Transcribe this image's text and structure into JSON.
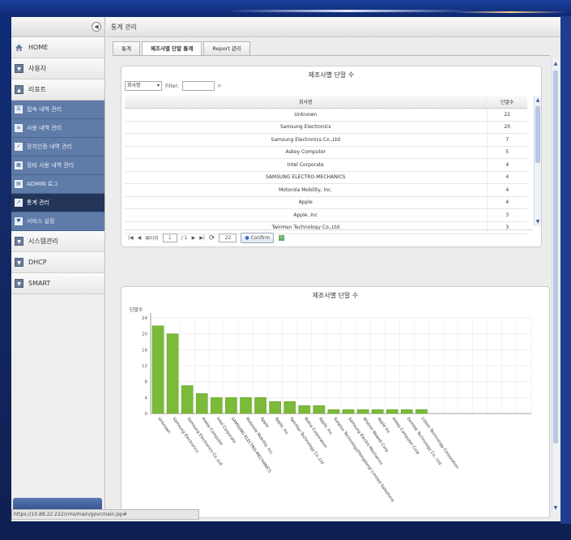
{
  "status_url": "https://10.88.22.222/cms/main/govcmain.jsp#",
  "sidebar": {
    "collapse_icon": "◀",
    "items": [
      {
        "label": "HOME",
        "icon": "home-icon"
      },
      {
        "label": "사용자",
        "icon": "expand-icon"
      },
      {
        "label": "리포트",
        "icon": "collapse-icon"
      }
    ],
    "report_subitems": [
      {
        "label": "접속 내역 관리",
        "icon": "list-icon"
      },
      {
        "label": "사용 내역 관리",
        "icon": "doc-icon"
      },
      {
        "label": "장치인증 내역 관리",
        "icon": "check-icon"
      },
      {
        "label": "장비 사용 내역 관리",
        "icon": "calendar-icon"
      },
      {
        "label": "ADMIN 로그",
        "icon": "log-icon"
      },
      {
        "label": "통계 관리",
        "icon": "chart-icon",
        "active": true
      },
      {
        "label": "서비스 설정",
        "icon": "setting-icon"
      }
    ],
    "items_after": [
      {
        "label": "시스템관리",
        "icon": "expand-icon"
      },
      {
        "label": "DHCP",
        "icon": "expand-icon"
      },
      {
        "label": "SMART",
        "icon": "expand-icon"
      }
    ]
  },
  "breadcrumb": "통계 관리",
  "tabs": [
    {
      "label": "통계",
      "active": false
    },
    {
      "label": "제조사별 단말 통계",
      "active": true
    },
    {
      "label": "Report 관리",
      "active": false
    }
  ],
  "table_panel": {
    "title": "제조사별 단말 수",
    "filter_select": "회사명",
    "filter_label": "Filter:",
    "filter_value": "",
    "columns": [
      "회사명",
      "단말수"
    ],
    "rows": [
      [
        "Unknown",
        "22"
      ],
      [
        "Samsung Electronics",
        "20"
      ],
      [
        "Samsung Electronics Co.,Ltd",
        "7"
      ],
      [
        "Askey Computer",
        "5"
      ],
      [
        "Intel Corporate",
        "4"
      ],
      [
        "SAMSUNG ELECTRO-MECHANICS",
        "4"
      ],
      [
        "Motorola Mobility, Inc.",
        "4"
      ],
      [
        "Apple",
        "4"
      ],
      [
        "Apple, Inc",
        "3"
      ],
      [
        "TwinHan Technology Co.,Ltd",
        "3"
      ]
    ],
    "pager": {
      "page_label": "페이지",
      "page_value": "1",
      "of_label": "/ 1",
      "page_size": "22",
      "confirm_label": "Confirm"
    }
  },
  "chart_panel": {
    "title": "제조사별 단말 수"
  },
  "chart_data": {
    "type": "bar",
    "title": "제조사별 단말 수",
    "ylabel": "단말수",
    "xlabel": "",
    "ylim": [
      0,
      24
    ],
    "yticks": [
      0,
      4,
      8,
      12,
      16,
      20,
      24
    ],
    "grid": true,
    "bar_color": "#7cba3a",
    "categories": [
      "Unknown",
      "Samsung Electronics",
      "Samsung Electronics Co.,Ltd",
      "Askey Computer",
      "Intel Corporate",
      "SAMSUNG ELECTRO-MECHANICS",
      "Motorola Mobility, Inc.",
      "Apple",
      "Apple, Inc",
      "TwinHan Technology Co.,Ltd",
      "Nokia Corporation",
      "Apple, Inc.",
      "Sunplus Technology(Hongkong) Limited Salesforce",
      "Samsung Electro Mechanics",
      "Wistron Neweb Corp.",
      "Apple Inc",
      "Askey Computer Corp",
      "Gemtek Technology Co., Ltd.",
      "Liteon Technology Corporation"
    ],
    "values": [
      22,
      20,
      7,
      5,
      4,
      4,
      4,
      4,
      3,
      3,
      2,
      2,
      1,
      1,
      1,
      1,
      1,
      1,
      1
    ]
  }
}
